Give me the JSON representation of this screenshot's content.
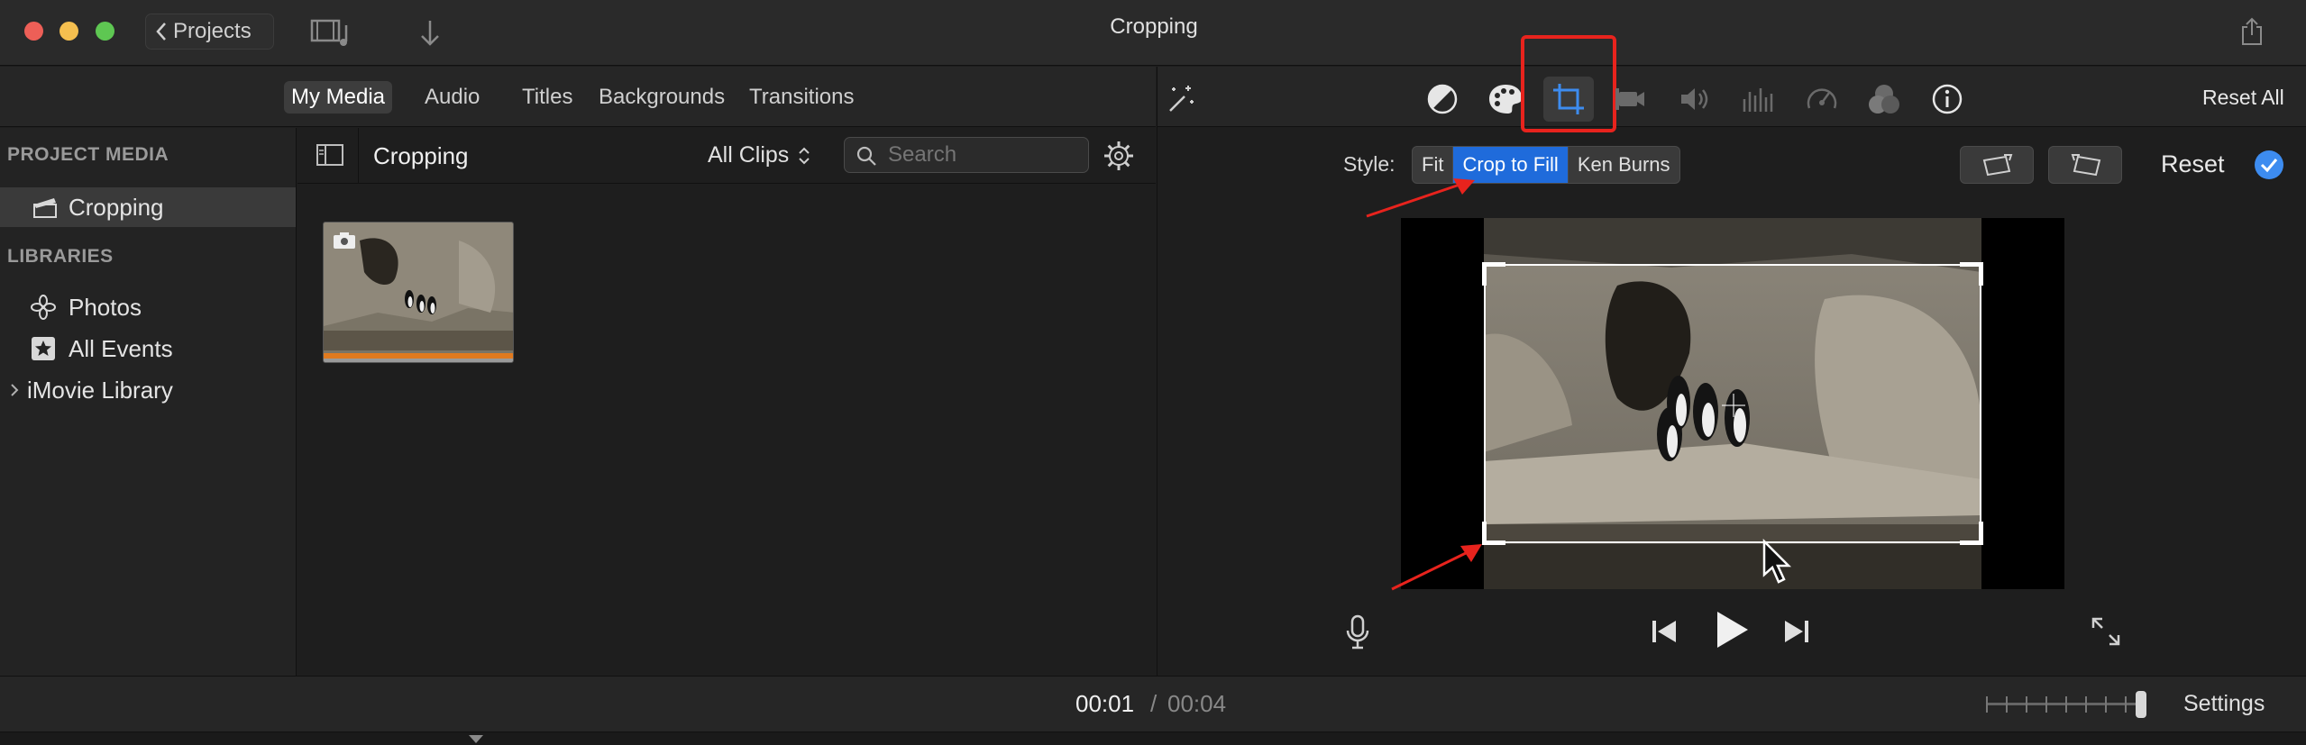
{
  "window": {
    "title": "Cropping"
  },
  "toolbar": {
    "projects_label": "Projects"
  },
  "media_tabs": {
    "items": [
      {
        "label": "My Media",
        "active": true
      },
      {
        "label": "Audio",
        "active": false
      },
      {
        "label": "Titles",
        "active": false
      },
      {
        "label": "Backgrounds",
        "active": false
      },
      {
        "label": "Transitions",
        "active": false
      }
    ]
  },
  "sidebar": {
    "project_media_header": "PROJECT MEDIA",
    "project_item": "Cropping",
    "libraries_header": "LIBRARIES",
    "libraries": [
      {
        "label": "Photos",
        "icon": "photos-icon"
      },
      {
        "label": "All Events",
        "icon": "star-icon"
      },
      {
        "label": "iMovie Library",
        "icon": "disclosure-icon"
      }
    ]
  },
  "browser": {
    "title": "Cropping",
    "filter_label": "All Clips",
    "search_placeholder": "Search"
  },
  "adjust": {
    "reset_all_label": "Reset All",
    "style_label": "Style:",
    "styles": [
      {
        "label": "Fit",
        "active": false
      },
      {
        "label": "Crop to Fill",
        "active": true
      },
      {
        "label": "Ken Burns",
        "active": false
      }
    ],
    "reset_label": "Reset",
    "tools": [
      "color-balance-icon",
      "color-palette-icon",
      "crop-icon",
      "stabilize-icon",
      "volume-icon",
      "equalizer-icon",
      "speed-icon",
      "filter-icon",
      "info-icon"
    ],
    "selected_tool": "crop-icon"
  },
  "playback": {
    "current_time": "00:01",
    "separator": "/",
    "total_time": "00:04",
    "settings_label": "Settings"
  },
  "colors": {
    "accent": "#1f6bdb",
    "highlight_box": "#e8231d",
    "annotation_arrow": "#e8231d",
    "clip_bar": "#e07a1f"
  }
}
